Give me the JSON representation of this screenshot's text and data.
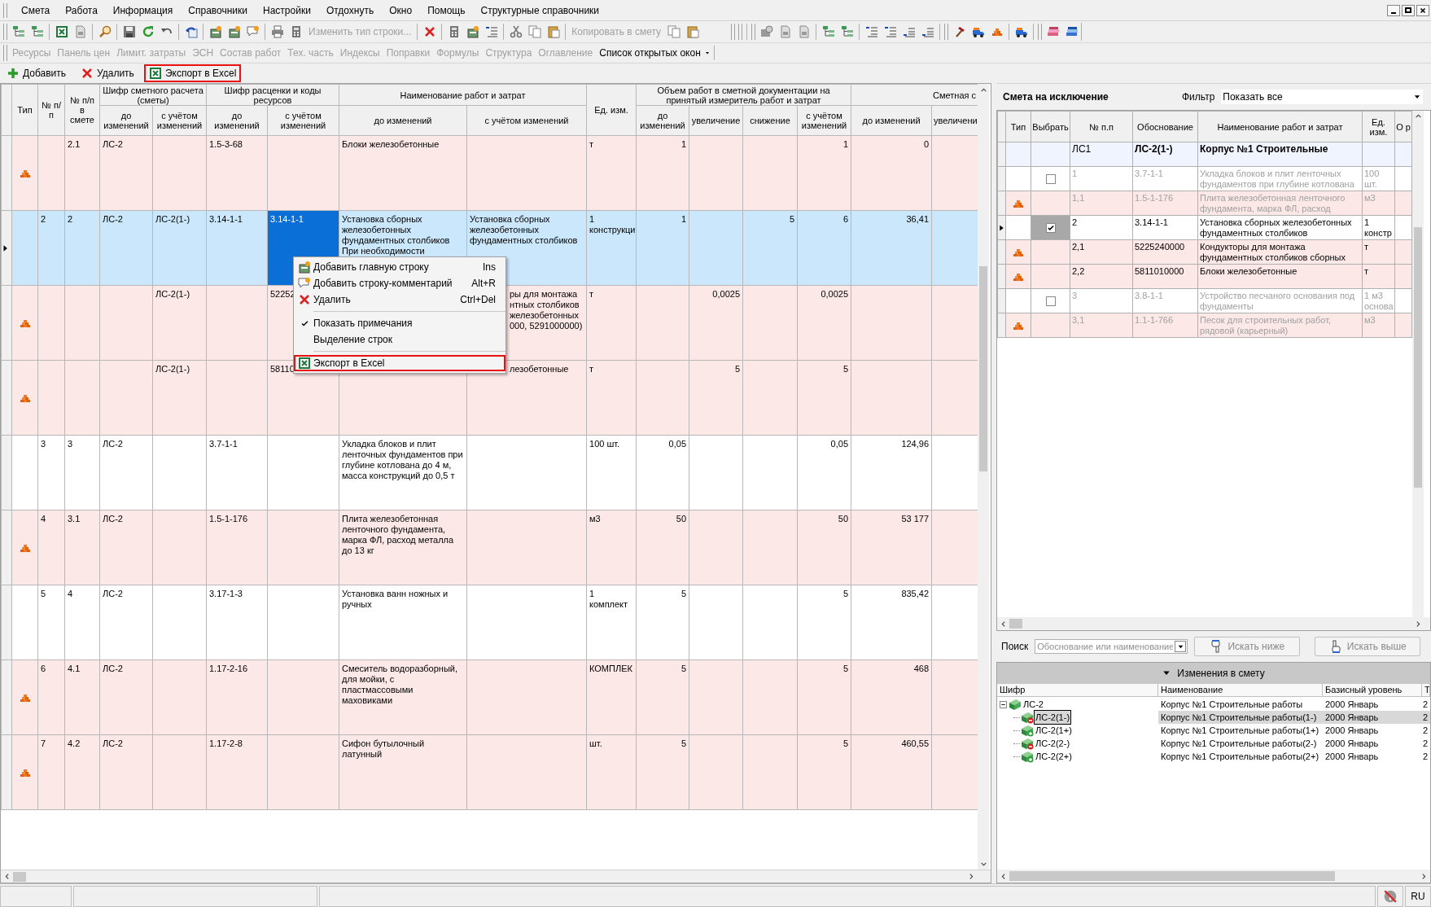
{
  "menu": [
    {
      "label": "Смета"
    },
    {
      "label": "Работа"
    },
    {
      "label": "Информация"
    },
    {
      "label": "Справочники"
    },
    {
      "label": "Настройки"
    },
    {
      "label": "Отдохнуть"
    },
    {
      "label": "Окно"
    },
    {
      "label": "Помощь"
    },
    {
      "label": "Структурные справочники"
    }
  ],
  "toolbar": {
    "buttons": [
      {
        "label": "Изменить тип строки...",
        "disabled": true
      },
      {
        "label": "Копировать в смету",
        "disabled": true
      }
    ]
  },
  "panels_toolbar": {
    "buttons": [
      {
        "label": "Ресурсы",
        "disabled": true
      },
      {
        "label": "Панель цен",
        "disabled": true
      },
      {
        "label": "Лимит. затраты",
        "disabled": true
      },
      {
        "label": "ЭСН",
        "disabled": true
      },
      {
        "label": "Состав работ",
        "disabled": true
      },
      {
        "label": "Тех. часть",
        "disabled": true
      },
      {
        "label": "Индексы",
        "disabled": true
      },
      {
        "label": "Поправки",
        "disabled": true
      },
      {
        "label": "Формулы",
        "disabled": true
      },
      {
        "label": "Структура",
        "disabled": true
      },
      {
        "label": "Оглавление",
        "disabled": true
      }
    ],
    "window_list": {
      "label": "Список открытых окон"
    }
  },
  "actions": [
    {
      "label": "Добавить",
      "kind": "add",
      "highlighted": false
    },
    {
      "label": "Удалить",
      "kind": "delete",
      "highlighted": false
    },
    {
      "label": "Экспорт в Excel",
      "kind": "excel",
      "highlighted": true
    }
  ],
  "main_table": {
    "columns": [
      {
        "label": "Тип"
      },
      {
        "label": "№ п/п"
      },
      {
        "label": "№ п/п в смете"
      },
      {
        "label": "Шифр сметного расчета (сметы)",
        "colspan": 2,
        "sub": [
          "до изменений",
          "с учётом изменений"
        ]
      },
      {
        "label": "Шифр расценки и коды ресурсов",
        "colspan": 2,
        "sub": [
          "до изменений",
          "с учётом изменений"
        ]
      },
      {
        "label": "Наименование работ и затрат",
        "colspan": 2,
        "sub": [
          "до изменений",
          "с учётом изменений"
        ]
      },
      {
        "label": "Ед. изм."
      },
      {
        "label": "Объем работ в сметной документации на принятый измеритель работ и затрат",
        "colspan": 4,
        "sub": [
          "до изменений",
          "увеличение",
          "снижение",
          "с учётом изменений"
        ]
      },
      {
        "label": "Сметная с",
        "colspan": 2,
        "sub": [
          "до изменений",
          "увеличени"
        ]
      }
    ],
    "rows": [
      {
        "kind": "resource",
        "selected": false,
        "cells": [
          "",
          "",
          "2.1",
          "ЛС-2",
          "",
          "1.5-3-68",
          "",
          "Блоки железобетонные",
          "",
          "т",
          "1",
          "",
          "",
          "1",
          "0",
          ""
        ]
      },
      {
        "kind": "work",
        "selected": true,
        "cells": [
          "",
          "2",
          "2",
          "ЛС-2",
          "ЛС-2(1-)",
          "3.14-1-1",
          {
            "text": "3.14-1-1",
            "focused": true
          },
          "Установка сборных железобетонных фундаментных столбиков При необходимости",
          "Установка сборных железобетонных фундаментных столбиков",
          "1 конструкци",
          "1",
          "",
          "5",
          "6",
          "36,41",
          ""
        ]
      },
      {
        "kind": "resource",
        "selected": false,
        "cells": [
          "",
          "",
          "",
          "",
          "ЛС-2(1-)",
          "",
          "52252",
          "",
          "ры для монтажа нтных столбиков железобетонных 000, 5291000000)",
          "т",
          "",
          "0,0025",
          "",
          "0,0025",
          "",
          ""
        ]
      },
      {
        "kind": "resource",
        "selected": false,
        "cells": [
          "",
          "",
          "",
          "",
          "ЛС-2(1-)",
          "",
          "58110",
          "",
          "лезобетонные",
          "т",
          "",
          "5",
          "",
          "5",
          "",
          ""
        ]
      },
      {
        "kind": "work",
        "selected": false,
        "cells": [
          "",
          "3",
          "3",
          "ЛС-2",
          "",
          "3.7-1-1",
          "",
          "Укладка блоков и плит ленточных фундаментов при глубине котлована до 4 м, масса конструкций до 0,5 т",
          "",
          "100 шт.",
          "0,05",
          "",
          "",
          "0,05",
          "124,96",
          ""
        ]
      },
      {
        "kind": "resource",
        "selected": false,
        "cells": [
          "",
          "4",
          "3.1",
          "ЛС-2",
          "",
          "1.5-1-176",
          "",
          "Плита железобетонная ленточного фундамента, марка ФЛ, расход металла до 13 кг",
          "",
          "м3",
          "50",
          "",
          "",
          "50",
          "53 177",
          ""
        ]
      },
      {
        "kind": "work",
        "selected": false,
        "cells": [
          "",
          "5",
          "4",
          "ЛС-2",
          "",
          "3.17-1-3",
          "",
          "Установка ванн ножных и ручных",
          "",
          "1 комплект",
          "5",
          "",
          "",
          "5",
          "835,42",
          ""
        ]
      },
      {
        "kind": "resource",
        "selected": false,
        "cells": [
          "",
          "6",
          "4.1",
          "ЛС-2",
          "",
          "1.17-2-16",
          "",
          "Смеситель водоразборный, для мойки, с пластмассовыми маховиками",
          "",
          "КОМПЛЕК",
          "5",
          "",
          "",
          "5",
          "468",
          ""
        ]
      },
      {
        "kind": "resource",
        "selected": false,
        "cells": [
          "",
          "7",
          "4.2",
          "ЛС-2",
          "",
          "1.17-2-8",
          "",
          "Сифон бутылочный латунный",
          "",
          "шт.",
          "5",
          "",
          "",
          "5",
          "460,55",
          ""
        ]
      }
    ]
  },
  "context_menu": {
    "items": [
      {
        "kind": "item",
        "label": "Добавить главную строку",
        "shortcut": "Ins",
        "highlighted": false
      },
      {
        "kind": "item",
        "label": "Добавить строку-комментарий",
        "shortcut": "Alt+R",
        "highlighted": false
      },
      {
        "kind": "item",
        "label": "Удалить",
        "shortcut": "Ctrl+Del",
        "highlighted": false
      },
      {
        "kind": "separator"
      },
      {
        "kind": "item",
        "label": "Показать примечания",
        "checked": true,
        "highlighted": false
      },
      {
        "kind": "item",
        "label": "Выделение строк",
        "checked": false,
        "highlighted": false
      },
      {
        "kind": "separator"
      },
      {
        "kind": "item",
        "label": "Экспорт в Excel",
        "highlighted": true
      }
    ]
  },
  "exclusion": {
    "title": "Смета на исключение",
    "filter": {
      "label": "Фильтр",
      "value": "Показать все"
    },
    "columns": [
      "Тип",
      "Выбрать",
      "№ п.п",
      "Обоснование",
      "Наименование работ и затрат",
      "Ед. изм.",
      "О р"
    ],
    "rows": [
      {
        "kind": "group",
        "selected": false,
        "number": "ЛС1",
        "basis": "ЛС-2(1-)",
        "name": "Корпус №1 Строительные",
        "unit": ""
      },
      {
        "kind": "work",
        "selected": false,
        "checked": false,
        "disabled": true,
        "number": "1",
        "basis": "3.7-1-1",
        "name": "Укладка блоков и плит ленточных фундаментов при глубине котлована",
        "unit": "100 шт."
      },
      {
        "kind": "resource",
        "selected": false,
        "disabled": true,
        "number": "1,1",
        "basis": "1.5-1-176",
        "name": "Плита железобетонная ленточного фундамента, марка ФЛ, расход",
        "unit": "м3"
      },
      {
        "kind": "work",
        "selected": true,
        "checked": true,
        "disabled": false,
        "number": "2",
        "basis": "3.14-1-1",
        "name": "Установка сборных железобетонных фундаментных столбиков",
        "unit": "1 констр"
      },
      {
        "kind": "resource",
        "selected": false,
        "disabled": false,
        "number": "2,1",
        "basis": "5225240000",
        "name": "Кондукторы для монтажа фундаментных столбиков сборных",
        "unit": "т"
      },
      {
        "kind": "resource",
        "selected": false,
        "disabled": false,
        "number": "2,2",
        "basis": "5811010000",
        "name": "Блоки железобетонные",
        "unit": "т"
      },
      {
        "kind": "work",
        "selected": false,
        "checked": false,
        "disabled": true,
        "number": "3",
        "basis": "3.8-1-1",
        "name": "Устройство песчаного основания под фундаменты",
        "unit": "1 м3 основа"
      },
      {
        "kind": "resource",
        "selected": false,
        "disabled": true,
        "number": "3,1",
        "basis": "1.1-1-766",
        "name": "Песок для строительных работ, рядовой (карьерный)",
        "unit": "м3"
      }
    ]
  },
  "search": {
    "label": "Поиск",
    "placeholder": "Обоснование или наименование",
    "buttons": [
      {
        "label": "Искать ниже",
        "disabled": true
      },
      {
        "label": "Искать выше",
        "disabled": true
      }
    ]
  },
  "changes": {
    "title": "Изменения в смету",
    "expanded": true,
    "columns": [
      "Шифр",
      "Наименование",
      "Базисный уровень",
      "Т"
    ],
    "tree": [
      {
        "kind": "estimate",
        "code": "ЛС-2",
        "name": "Корпус №1 Строительные работы",
        "base_level": "2000 Январь",
        "column_4": "2",
        "expanded": true,
        "selected": false,
        "children": [
          {
            "kind": "minus",
            "code": "ЛС-2(1-)",
            "name": "Корпус №1 Строительные работы(1-)",
            "base_level": "2000 Январь",
            "column_4": "2",
            "selected": true
          },
          {
            "kind": "plus",
            "code": "ЛС-2(1+)",
            "name": "Корпус №1 Строительные работы(1+)",
            "base_level": "2000 Январь",
            "column_4": "2",
            "selected": false
          },
          {
            "kind": "minus",
            "code": "ЛС-2(2-)",
            "name": "Корпус №1 Строительные работы(2-)",
            "base_level": "2000 Январь",
            "column_4": "2",
            "selected": false
          },
          {
            "kind": "plus",
            "code": "ЛС-2(2+)",
            "name": "Корпус №1 Строительные работы(2+)",
            "base_level": "2000 Январь",
            "column_4": "2",
            "selected": false
          }
        ]
      }
    ]
  },
  "status_bar": {
    "language": "RU"
  }
}
